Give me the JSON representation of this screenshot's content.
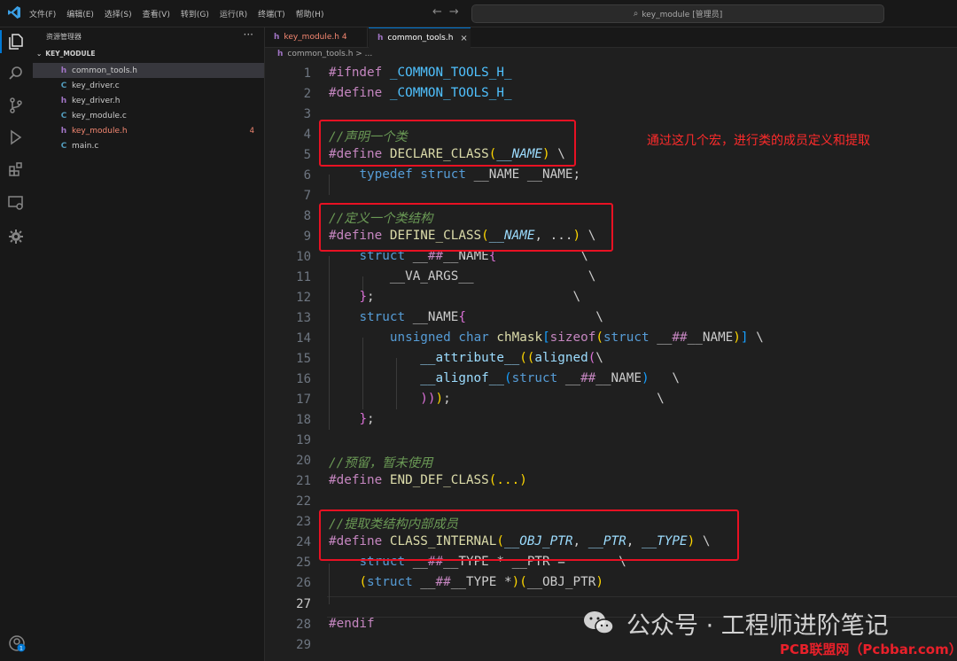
{
  "menu": [
    "文件(F)",
    "编辑(E)",
    "选择(S)",
    "查看(V)",
    "转到(G)",
    "运行(R)",
    "终端(T)",
    "帮助(H)"
  ],
  "search": {
    "text": "key_module [管理员]"
  },
  "sidebar": {
    "title": "资源管理器",
    "more": "···",
    "folder": "KEY_MODULE",
    "files": [
      {
        "icon": "h",
        "name": "common_tools.h",
        "badge": ""
      },
      {
        "icon": "C",
        "name": "key_driver.c",
        "badge": ""
      },
      {
        "icon": "h",
        "name": "key_driver.h",
        "badge": ""
      },
      {
        "icon": "C",
        "name": "key_module.c",
        "badge": ""
      },
      {
        "icon": "h",
        "name": "key_module.h",
        "badge": "4"
      },
      {
        "icon": "C",
        "name": "main.c",
        "badge": ""
      }
    ]
  },
  "tabs": [
    {
      "icon": "h",
      "label": "key_module.h 4"
    },
    {
      "icon": "h",
      "label": "common_tools.h",
      "close": "×"
    }
  ],
  "breadcrumb": {
    "icon": "h",
    "text": "common_tools.h > ..."
  },
  "line_numbers": [
    "1",
    "2",
    "3",
    "4",
    "5",
    "6",
    "7",
    "8",
    "9",
    "10",
    "11",
    "12",
    "13",
    "14",
    "15",
    "16",
    "17",
    "18",
    "19",
    "20",
    "21",
    "22",
    "23",
    "24",
    "25",
    "26",
    "27",
    "28",
    "29"
  ],
  "code": {
    "l1_a": "#ifndef",
    "l1_b": " _COMMON_TOOLS_H_",
    "l2_a": "#define",
    "l2_b": " _COMMON_TOOLS_H_",
    "l4": "//声明一个类",
    "l5_a": "#define",
    "l5_b": " DECLARE_CLASS",
    "l5_c": "(",
    "l5_d": "__NAME",
    "l5_e": ")",
    "l5_f": " \\",
    "l6_a": "typedef",
    "l6_b": " struct",
    "l6_c": " __NAME __NAME;",
    "l8": "//定义一个类结构",
    "l9_a": "#define",
    "l9_b": " DEFINE_CLASS",
    "l9_c": "(",
    "l9_d": "__NAME",
    "l9_e": ", ...",
    "l9_f": ")",
    "l9_g": " \\",
    "l10_a": "struct",
    "l10_b": " __",
    "l10_c": "##",
    "l10_d": "__NAME",
    "l10_e": "{",
    "l10_f": "\\",
    "l11_a": "__VA_ARGS__",
    "l11_b": "\\",
    "l12_a": "}",
    "l12_b": ";",
    "l12_c": "\\",
    "l13_a": "struct",
    "l13_b": " __NAME",
    "l13_c": "{",
    "l13_d": "\\",
    "l14_a": "unsigned",
    "l14_b": " char",
    "l14_c": " chMask",
    "l14_d": "[",
    "l14_e": "sizeof",
    "l14_f": "(",
    "l14_g": "struct",
    "l14_h": " __",
    "l14_i": "##",
    "l14_j": "__NAME",
    "l14_k": ")",
    "l14_l": "]",
    "l14_m": " \\",
    "l15_a": "__attribute__",
    "l15_b": "((",
    "l15_c": "aligned",
    "l15_d": "(",
    "l15_e": "\\",
    "l16_a": "__alignof__",
    "l16_b": "(",
    "l16_c": "struct",
    "l16_d": " __",
    "l16_e": "##",
    "l16_f": "__NAME",
    "l16_g": ")",
    "l16_h": "\\",
    "l17_a": "))",
    "l17_b": ")",
    "l17_c": ";",
    "l17_d": "\\",
    "l18_a": "}",
    "l18_b": ";",
    "l20": "//预留，暂未使用",
    "l21_a": "#define",
    "l21_b": " END_DEF_CLASS",
    "l21_c": "(...)",
    "l23": "//提取类结构内部成员",
    "l24_a": "#define",
    "l24_b": " CLASS_INTERNAL",
    "l24_c": "(",
    "l24_d": "__OBJ_PTR",
    "l24_e": ", ",
    "l24_f": "__PTR",
    "l24_g": ", ",
    "l24_h": "__TYPE",
    "l24_i": ")",
    "l24_j": " \\",
    "l25_a": "struct",
    "l25_b": " __",
    "l25_c": "##",
    "l25_d": "__TYPE * __PTR =",
    "l25_e": "\\",
    "l26_a": "(",
    "l26_b": "struct",
    "l26_c": " __",
    "l26_d": "##",
    "l26_e": "__TYPE *",
    "l26_f": ")(",
    "l26_g": "__OBJ_PTR",
    "l26_h": ")",
    "l28": "#endif"
  },
  "annotation": "通过这几个宏，进行类的成员定义和提取",
  "watermark": "公众号 · 工程师进阶笔记",
  "site_watermark": "PCB联盟网（Pcbbar.com）",
  "status_badge": "1",
  "colors": {
    "accent": "#0078d4",
    "highlight_box": "#e81123",
    "annotation": "#ff2b2b",
    "error": "#f48771"
  }
}
